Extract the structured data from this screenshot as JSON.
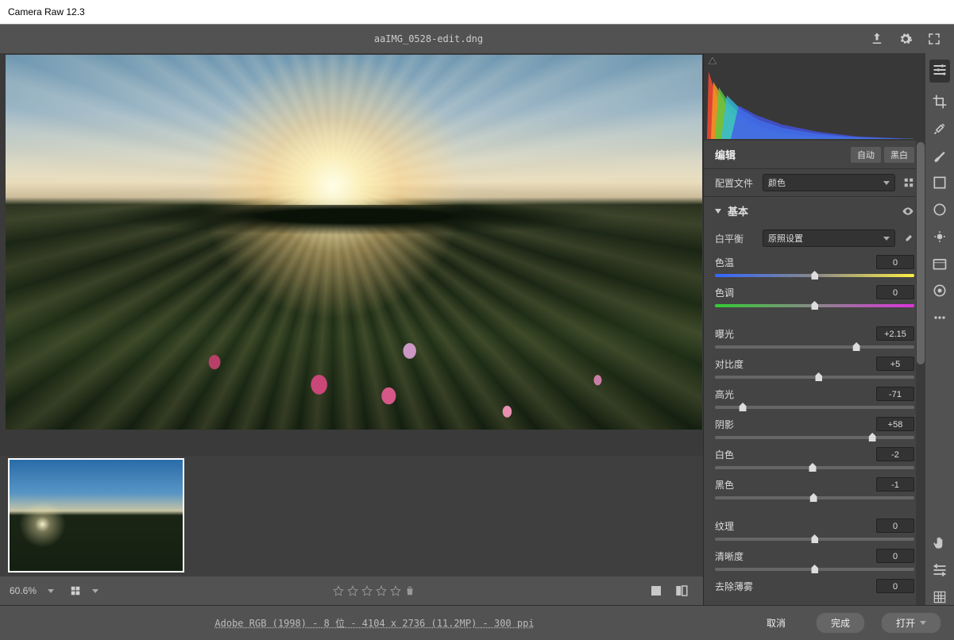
{
  "app_title": "Camera Raw 12.3",
  "filename": "aaIMG_0528-edit.dng",
  "zoom": "60.6%",
  "footer_info": "Adobe RGB (1998) - 8 位 - 4104 x 2736 (11.2MP) - 300 ppi",
  "buttons": {
    "cancel": "取消",
    "done": "完成",
    "open": "打开"
  },
  "edit_panel": {
    "title": "编辑",
    "auto": "自动",
    "bw": "黑白"
  },
  "profile": {
    "label": "配置文件",
    "value": "颜色"
  },
  "basic": {
    "title": "基本"
  },
  "wb": {
    "label": "白平衡",
    "value": "原照设置"
  },
  "sliders": {
    "temp": {
      "label": "色温",
      "value": "0"
    },
    "tint": {
      "label": "色调",
      "value": "0"
    },
    "exp": {
      "label": "曝光",
      "value": "+2.15"
    },
    "con": {
      "label": "对比度",
      "value": "+5"
    },
    "hi": {
      "label": "高光",
      "value": "-71"
    },
    "sh": {
      "label": "阴影",
      "value": "+58"
    },
    "wh": {
      "label": "白色",
      "value": "-2"
    },
    "bl": {
      "label": "黑色",
      "value": "-1"
    },
    "tex": {
      "label": "纹理",
      "value": "0"
    },
    "cla": {
      "label": "清晰度",
      "value": "0"
    },
    "deh": {
      "label": "去除薄雾",
      "value": "0"
    }
  }
}
